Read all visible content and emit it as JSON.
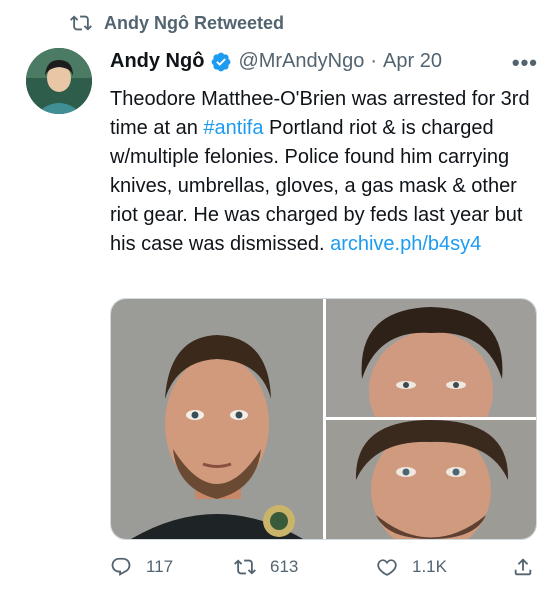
{
  "retweet": {
    "label": "Andy Ngô Retweeted",
    "icon": "retweet-icon"
  },
  "author": {
    "name": "Andy Ngô",
    "handle": "@MrAndyNgo",
    "separator": "·",
    "date": "Apr 20",
    "verified_icon": "verified-badge-icon"
  },
  "more_icon": "more-options-icon",
  "text": {
    "part1": "Theodore Matthee-O'Brien was arrested for 3rd time at an ",
    "hashtag": "#antifa",
    "part2": " Portland riot & is charged w/multiple felonies. Police found him carrying knives, umbrellas, gloves, a gas mask & other riot gear. He was charged by feds last year but his case was dismissed. ",
    "link": "archive.ph/b4sy4"
  },
  "actions": {
    "replies": "117",
    "retweets": "613",
    "likes": "1.1K",
    "icons": [
      "reply-icon",
      "retweet-icon",
      "like-icon",
      "share-icon"
    ]
  },
  "colors": {
    "accent": "#1d9bf0",
    "secondary_text": "#536471",
    "text": "#0f1419"
  }
}
